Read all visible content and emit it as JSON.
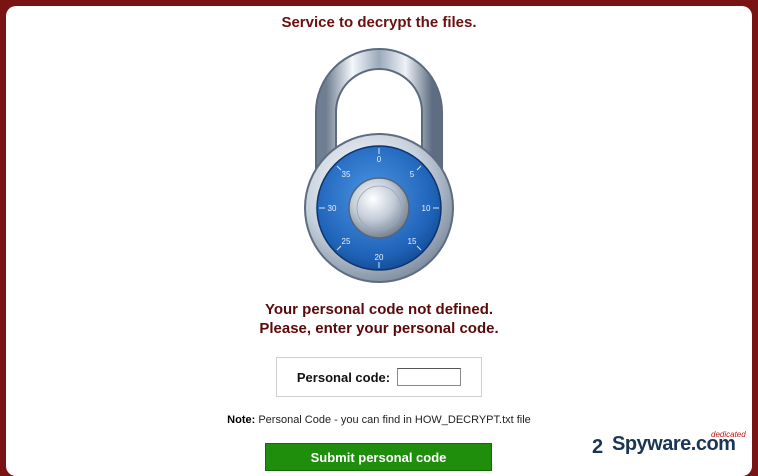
{
  "page": {
    "title": "Service to decrypt the files.",
    "message_line1": "Your personal code not defined.",
    "message_line2": "Please, enter your personal code."
  },
  "form": {
    "code_label": "Personal code:",
    "code_value": "",
    "note_prefix": "Note:",
    "note_text": " Personal Code - you can find in HOW_DECRYPT.txt file",
    "submit_label": "Submit personal code"
  },
  "dial": {
    "numbers": [
      "0",
      "5",
      "10",
      "15",
      "20",
      "25",
      "30",
      "35"
    ]
  },
  "icons": {
    "lock": "padlock-icon",
    "watermark_logo": "2spyware-logo-icon"
  },
  "watermark": {
    "text": "Spyware.com",
    "badge": "dedicated"
  },
  "colors": {
    "frame": "#7a1414",
    "title": "#6b0f0f",
    "submit_bg": "#1f8e0c",
    "dial_blue": "#1f63b8"
  }
}
